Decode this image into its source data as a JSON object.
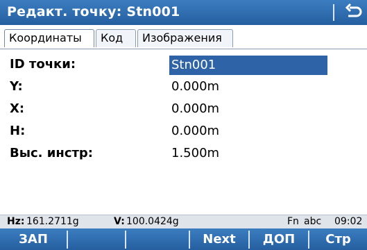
{
  "titlebar": {
    "title": "Редакт. точку: Stn001",
    "back_icon": "return-arrow-icon"
  },
  "tabs": [
    {
      "label": "Координаты",
      "active": true
    },
    {
      "label": "Код",
      "active": false
    },
    {
      "label": "Изображения",
      "active": false
    }
  ],
  "fields": [
    {
      "label": "ID точки:",
      "value": "Stn001"
    },
    {
      "label": "Y:",
      "value": "0.000m"
    },
    {
      "label": "X:",
      "value": "0.000m"
    },
    {
      "label": "H:",
      "value": "0.000m"
    },
    {
      "label": "Выс. инстр:",
      "value": "1.500m"
    }
  ],
  "status": {
    "hz_label": "Hz:",
    "hz_value": "161.2711g",
    "v_label": "V:",
    "v_value": "100.0424g",
    "fn": "Fn",
    "input_mode": "abc",
    "time": "09:02"
  },
  "softkeys": [
    {
      "label": "ЗАП"
    },
    {
      "label": ""
    },
    {
      "label": ""
    },
    {
      "label": "Next"
    },
    {
      "label": "ДОП"
    },
    {
      "label": "Стр"
    }
  ],
  "colors": {
    "bar": "#2f6db3",
    "selection": "#2f63a8",
    "status_bg": "#dfe4ea"
  }
}
